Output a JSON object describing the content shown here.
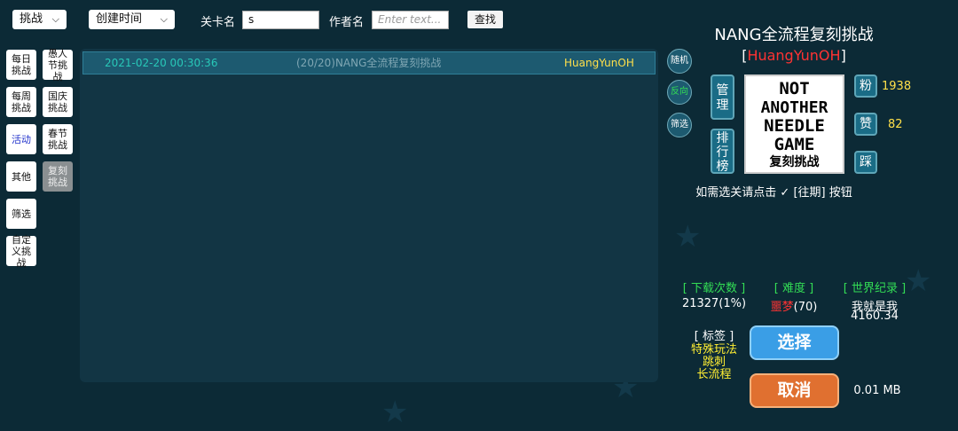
{
  "toolbar": {
    "category_select": "挑战",
    "sort_select": "创建时间",
    "level_name_label": "关卡名",
    "level_name_value": "s",
    "author_label": "作者名",
    "author_placeholder": "Enter text...",
    "search_button": "查找"
  },
  "categories": [
    {
      "label": "每日挑战"
    },
    {
      "label": "愚人节挑战"
    },
    {
      "label": "每周挑战"
    },
    {
      "label": "国庆挑战"
    },
    {
      "label": "活动"
    },
    {
      "label": "春节挑战"
    },
    {
      "label": "其他"
    },
    {
      "label": "复刻挑战"
    },
    {
      "label": "筛选"
    },
    {
      "label": "自定义挑战"
    }
  ],
  "list": {
    "rows": [
      {
        "date": "2021-02-20 00:30:36",
        "title": "(20/20)NANG全流程复刻挑战",
        "author": "HuangYunOH"
      }
    ]
  },
  "side_buttons": {
    "random": "随机",
    "reverse": "反向",
    "filter": "筛选"
  },
  "detail": {
    "title": "NANG全流程复刻挑战",
    "author": "HuangYunOH",
    "bracket_left": "[",
    "bracket_right": "]",
    "manage_button": "管理",
    "ranking_button": "排行榜",
    "thumbnail_lines": [
      "NOT",
      "ANOTHER",
      "NEEDLE",
      "GAME"
    ],
    "thumbnail_caption": "复刻挑战",
    "fans_button": "粉",
    "fans_count": "1938",
    "like_button": "赞",
    "like_count": "82",
    "dislike_button": "踩",
    "hint": "如需选关请点击 ✓ [往期] 按钮",
    "downloads_label": "[ 下载次数 ]",
    "downloads_value": "21327(1%)",
    "difficulty_label": "[ 难度 ]",
    "difficulty_name": "噩梦",
    "difficulty_value": "(70)",
    "record_label": "[ 世界纪录 ]",
    "record_holder": "我就是我",
    "record_value": "4160.34",
    "tags_label": "[ 标签 ]",
    "tags": [
      "特殊玩法",
      "跳刺",
      "长流程"
    ],
    "select_button": "选择",
    "cancel_button": "取消",
    "file_size": "0.01 MB"
  },
  "colors": {
    "background": "#0c2a36",
    "accent_cyan": "#28c8b8",
    "author_red": "#ff3333",
    "highlight_yellow": "#ffe04a",
    "tag_yellow": "#ffee33",
    "label_green": "#33dd55",
    "select_blue": "#3a9ee6",
    "cancel_orange": "#e07030"
  }
}
